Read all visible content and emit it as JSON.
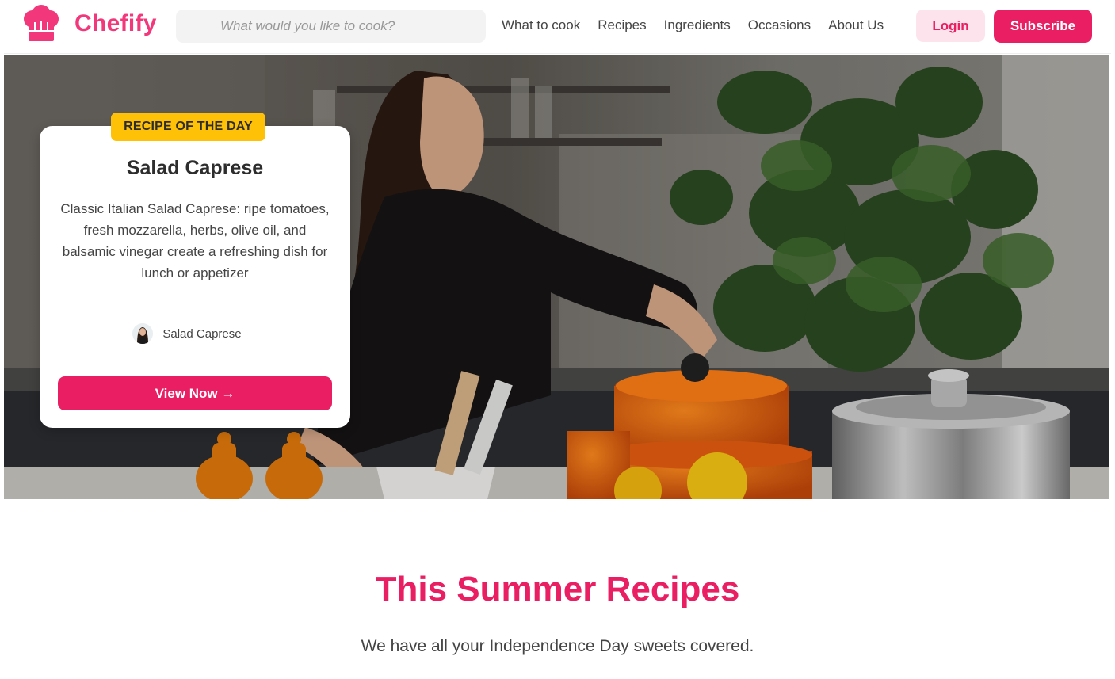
{
  "brand": {
    "name": "Chefify",
    "accent": "#e91e63",
    "logo_icon": "chef-hat-icon"
  },
  "search": {
    "placeholder": "What would you like to cook?",
    "value": ""
  },
  "nav": {
    "items": [
      {
        "label": "What to cook"
      },
      {
        "label": "Recipes"
      },
      {
        "label": "Ingredients"
      },
      {
        "label": "Occasions"
      },
      {
        "label": "About Us"
      }
    ]
  },
  "auth": {
    "login_label": "Login",
    "subscribe_label": "Subscribe"
  },
  "hero": {
    "badge": "RECIPE OF THE DAY",
    "title": "Salad Caprese",
    "description": "Classic Italian Salad Caprese: ripe tomatoes, fresh mozzarella, herbs, olive oil, and balsamic vinegar create a refreshing dish for lunch or appetizer",
    "author": "Salad Caprese",
    "cta": "View Now →",
    "badge_color": "#ffc107"
  },
  "section": {
    "title": "This Summer Recipes",
    "subtitle": "We have all your Independence Day sweets covered."
  }
}
